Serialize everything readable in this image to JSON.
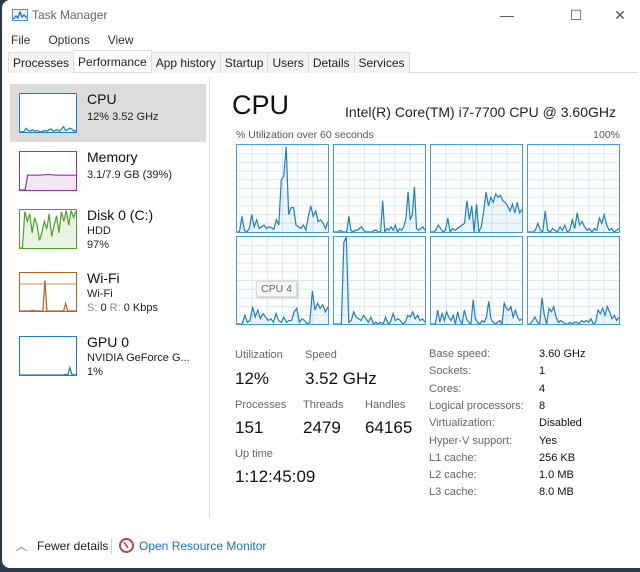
{
  "window": {
    "title": "Task Manager",
    "controls": {
      "minimize": "—",
      "maximize": "☐",
      "close": "✕"
    }
  },
  "menu": [
    "File",
    "Options",
    "View"
  ],
  "tabs": [
    {
      "label": "Processes",
      "active": false
    },
    {
      "label": "Performance",
      "active": true
    },
    {
      "label": "App history",
      "active": false
    },
    {
      "label": "Startup",
      "active": false
    },
    {
      "label": "Users",
      "active": false
    },
    {
      "label": "Details",
      "active": false
    },
    {
      "label": "Services",
      "active": false
    }
  ],
  "sidebar": {
    "items": [
      {
        "name": "CPU",
        "line1": "12% 3.52 GHz",
        "line2": "",
        "color": "#1f7fbf",
        "active": true
      },
      {
        "name": "Memory",
        "line1": "3.1/7.9 GB (39%)",
        "line2": "",
        "color": "#9b2fae",
        "active": false
      },
      {
        "name": "Disk 0 (C:)",
        "line1": "HDD",
        "line2": "97%",
        "color": "#4ca22a",
        "active": false
      },
      {
        "name": "Wi-Fi",
        "line1": "Wi-Fi",
        "line2_s_label": "S:",
        "line2_s_val": "0",
        "line2_r_label": "R:",
        "line2_r_val": "0 Kbps",
        "color": "#b5651d",
        "active": false
      },
      {
        "name": "GPU 0",
        "line1": "NVIDIA GeForce G...",
        "line2": "1%",
        "color": "#1f7fbf",
        "active": false
      }
    ]
  },
  "main": {
    "title": "CPU",
    "cpu_name": "Intel(R) Core(TM) i7-7700 CPU @ 3.60GHz",
    "util_label": "% Utilization over 60 seconds",
    "util_max": "100%",
    "tooltip": "CPU 4",
    "graph_color": "#1f7fbf",
    "stats": {
      "utilization": {
        "label": "Utilization",
        "value": "12%"
      },
      "speed": {
        "label": "Speed",
        "value": "3.52 GHz"
      },
      "processes": {
        "label": "Processes",
        "value": "151"
      },
      "threads": {
        "label": "Threads",
        "value": "2479"
      },
      "handles": {
        "label": "Handles",
        "value": "64165"
      },
      "uptime": {
        "label": "Up time",
        "value": "1:12:45:09"
      }
    },
    "specs": [
      {
        "key": "Base speed:",
        "value": "3.60 GHz"
      },
      {
        "key": "Sockets:",
        "value": "1"
      },
      {
        "key": "Cores:",
        "value": "4"
      },
      {
        "key": "Logical processors:",
        "value": "8"
      },
      {
        "key": "Virtualization:",
        "value": "Disabled"
      },
      {
        "key": "Hyper-V support:",
        "value": "Yes"
      },
      {
        "key": "L1 cache:",
        "value": "256 KB"
      },
      {
        "key": "L2 cache:",
        "value": "1.0 MB"
      },
      {
        "key": "L3 cache:",
        "value": "8.0 MB"
      }
    ],
    "core_graphs": [
      [
        0,
        0,
        18,
        2,
        0,
        4,
        20,
        6,
        14,
        4,
        6,
        8,
        4,
        6,
        5,
        3,
        14,
        8,
        60,
        64,
        98,
        20,
        28,
        28,
        8,
        6,
        4,
        8,
        2,
        18,
        30,
        18,
        24,
        12,
        14,
        10,
        4,
        12
      ],
      [
        0,
        0,
        0,
        2,
        0,
        0,
        0,
        18,
        2,
        0,
        2,
        2,
        4,
        6,
        2,
        0,
        0,
        0,
        0,
        2,
        2,
        0,
        0,
        36,
        0,
        4,
        2,
        6,
        2,
        8,
        0,
        4,
        2,
        6,
        16,
        46,
        14,
        20,
        52,
        4,
        2,
        4,
        6,
        2
      ],
      [
        0,
        0,
        2,
        8,
        4,
        0,
        2,
        16,
        0,
        4,
        2,
        4,
        6,
        8,
        10,
        36,
        14,
        30,
        0,
        32,
        0,
        6,
        24,
        46,
        30,
        40,
        34,
        44,
        40,
        42,
        36,
        34,
        30,
        24,
        32,
        22,
        34,
        22,
        26
      ],
      [
        0,
        0,
        0,
        2,
        10,
        2,
        0,
        24,
        2,
        0,
        4,
        2,
        0,
        6,
        2,
        8,
        0,
        2,
        14,
        4,
        22,
        8,
        12,
        6,
        2,
        4,
        0,
        4,
        2,
        16,
        10,
        20,
        8,
        2,
        4,
        0,
        2,
        4
      ],
      [
        0,
        0,
        0,
        10,
        2,
        4,
        20,
        8,
        16,
        6,
        12,
        8,
        4,
        6,
        2,
        12,
        4,
        2,
        8,
        2,
        4,
        4,
        14,
        18,
        2,
        6,
        4,
        0,
        2,
        38,
        16,
        24,
        18,
        22,
        14,
        20
      ],
      [
        0,
        0,
        0,
        0,
        94,
        100,
        2,
        4,
        14,
        8,
        6,
        4,
        10,
        6,
        2,
        8,
        0,
        2,
        0,
        2,
        0,
        8,
        0,
        2,
        12,
        4,
        6,
        4,
        0,
        2,
        10,
        8,
        14,
        6,
        10,
        4,
        6,
        2
      ],
      [
        0,
        0,
        0,
        16,
        2,
        12,
        4,
        14,
        8,
        4,
        10,
        0,
        14,
        4,
        0,
        16,
        6,
        2,
        0,
        28,
        6,
        2,
        0,
        4,
        2,
        8,
        26,
        6,
        2,
        0,
        2,
        4,
        0,
        24,
        18,
        16,
        20,
        8,
        16,
        8,
        4,
        6
      ],
      [
        0,
        0,
        4,
        8,
        2,
        0,
        30,
        10,
        0,
        18,
        14,
        20,
        8,
        2,
        4,
        2,
        0,
        0,
        2,
        0,
        2,
        2,
        0,
        4,
        2,
        4,
        2,
        6,
        0,
        2,
        16,
        12,
        18,
        10,
        20,
        14,
        6,
        10,
        4,
        8
      ]
    ],
    "sidebar_graphs": {
      "cpu": [
        0,
        0,
        2,
        10,
        4,
        2,
        6,
        2,
        4,
        2,
        0,
        2,
        4,
        2,
        6,
        8,
        2,
        4,
        6,
        2,
        8,
        14,
        4,
        6,
        10,
        8,
        2,
        4
      ],
      "memory": [
        0,
        0,
        0,
        39,
        39,
        39,
        39,
        39,
        39,
        40,
        40,
        41,
        40,
        40,
        39,
        39,
        39,
        39,
        39,
        39,
        39,
        39,
        39
      ],
      "disk": [
        0,
        0,
        96,
        70,
        90,
        40,
        80,
        60,
        20,
        40,
        70,
        50,
        90,
        30,
        60,
        85,
        40,
        95,
        70,
        98,
        60,
        99,
        80,
        97
      ],
      "wifi": [
        0,
        0,
        0,
        0,
        0,
        0,
        2,
        0,
        0,
        0,
        0,
        0,
        80,
        0,
        0,
        0,
        0,
        0,
        0,
        0,
        0,
        0,
        20,
        0,
        0,
        0,
        0,
        0
      ],
      "gpu": [
        0,
        0,
        0,
        0,
        0,
        0,
        0,
        0,
        0,
        0,
        0,
        0,
        0,
        0,
        0,
        0,
        0,
        0,
        0,
        0,
        0,
        0,
        2,
        0,
        20,
        2,
        0,
        0
      ]
    }
  },
  "footer": {
    "fewer_details": "Fewer details",
    "resource_monitor": "Open Resource Monitor"
  }
}
